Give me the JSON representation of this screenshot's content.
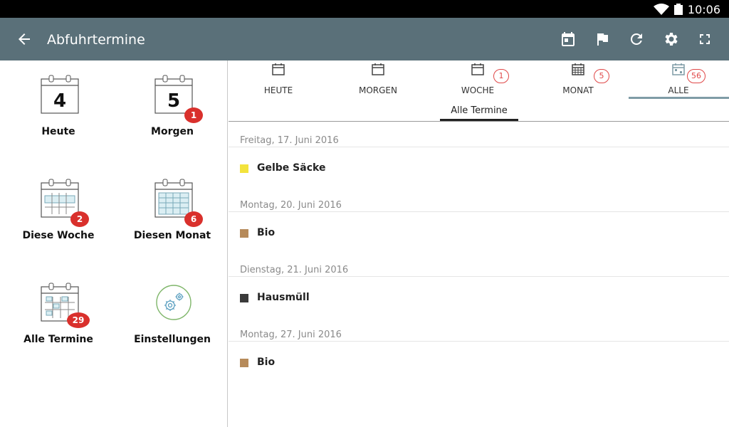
{
  "status": {
    "time": "10:06"
  },
  "appbar": {
    "title": "Abfuhrtermine",
    "actions": [
      "calendar-today-icon",
      "flag-icon",
      "refresh-icon",
      "settings-icon",
      "fullscreen-icon"
    ]
  },
  "tiles": [
    {
      "label": "Heute",
      "day": "4",
      "badge": ""
    },
    {
      "label": "Morgen",
      "day": "5",
      "badge": "1"
    },
    {
      "label": "Diese Woche",
      "badge": "2"
    },
    {
      "label": "Diesen Monat",
      "badge": "6"
    },
    {
      "label": "Alle Termine",
      "badge": "29"
    },
    {
      "label": "Einstellungen",
      "badge": ""
    }
  ],
  "tabs": [
    {
      "label": "HEUTE",
      "badge": ""
    },
    {
      "label": "MORGEN",
      "badge": ""
    },
    {
      "label": "WOCHE",
      "badge": "1"
    },
    {
      "label": "MONAT",
      "badge": "5"
    },
    {
      "label": "ALLE",
      "badge": "56"
    }
  ],
  "subtab": "Alle Termine",
  "groups": [
    {
      "date": "Freitag, 17. Juni 2016",
      "item": "Gelbe Säcke",
      "color": "#f3e33c"
    },
    {
      "date": "Montag, 20. Juni 2016",
      "item": "Bio",
      "color": "#b68a5a"
    },
    {
      "date": "Dienstag, 21. Juni 2016",
      "item": "Hausmüll",
      "color": "#3a3a3a"
    },
    {
      "date": "Montag, 27. Juni 2016",
      "item": "Bio",
      "color": "#b68a5a"
    }
  ],
  "colors": {
    "appbar": "#5a7079",
    "badge_red": "#d9302c",
    "tab_accent": "#7f9ca6"
  }
}
